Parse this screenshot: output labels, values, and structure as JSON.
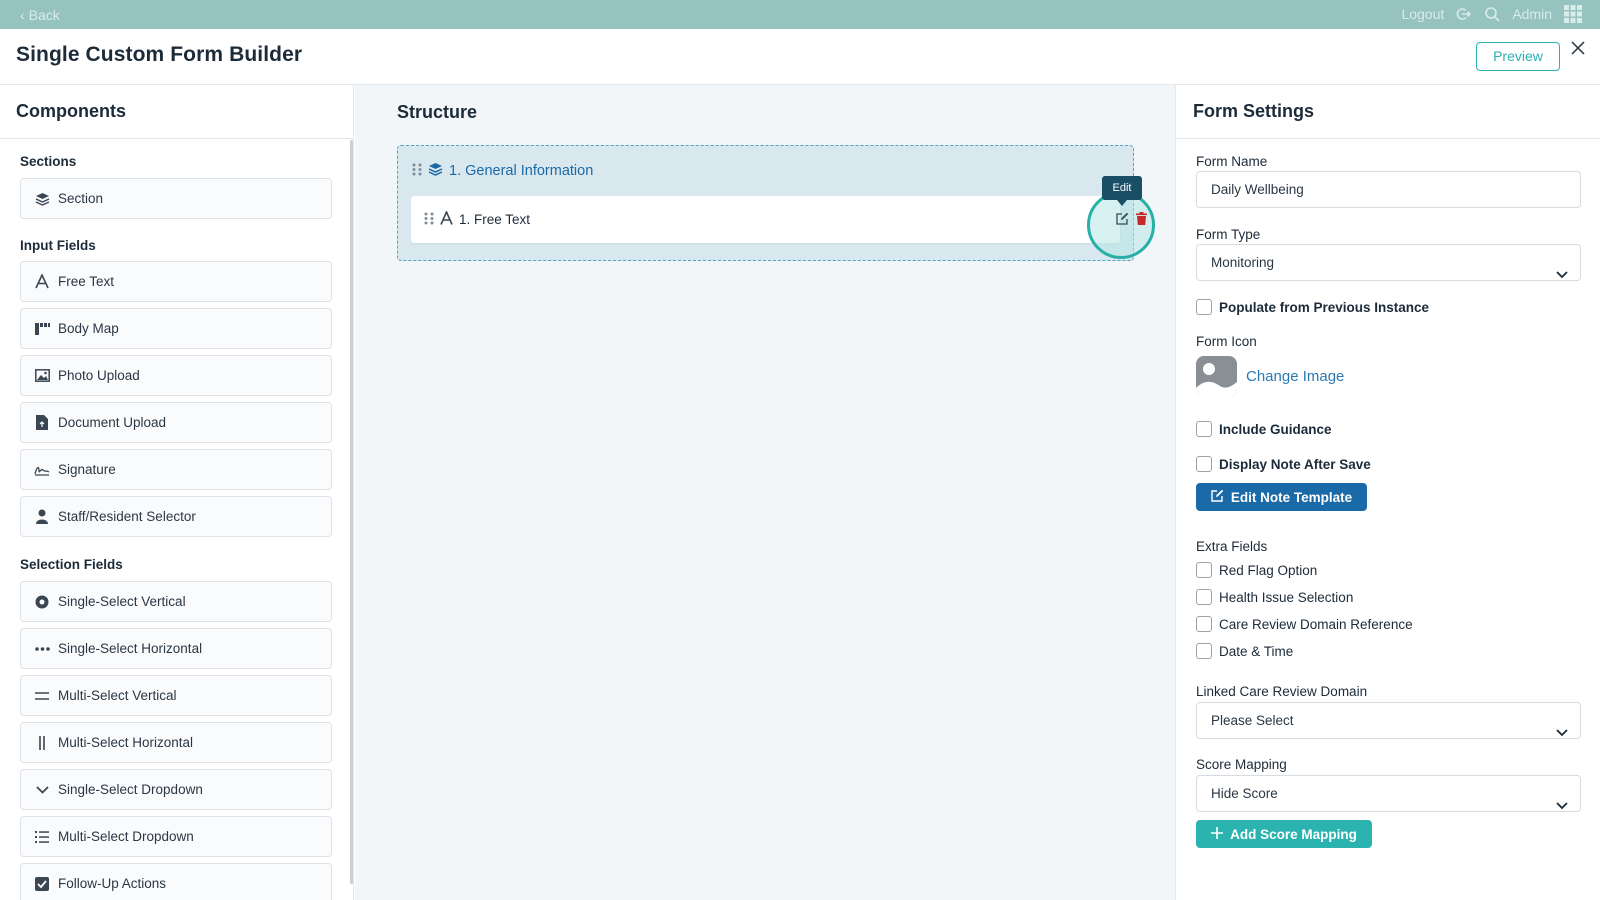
{
  "topbar": {
    "back_label": "Back",
    "logout_label": "Logout",
    "user_label": "Admin"
  },
  "header": {
    "title": "Single Custom Form Builder",
    "preview_label": "Preview"
  },
  "components": {
    "title": "Components",
    "groups": [
      {
        "label": "Sections",
        "items": [
          {
            "label": "Section",
            "icon": "layers-icon"
          }
        ]
      },
      {
        "label": "Input Fields",
        "items": [
          {
            "label": "Free Text",
            "icon": "text-a-icon"
          },
          {
            "label": "Body Map",
            "icon": "body-map-icon"
          },
          {
            "label": "Photo Upload",
            "icon": "image-icon"
          },
          {
            "label": "Document Upload",
            "icon": "file-icon"
          },
          {
            "label": "Signature",
            "icon": "signature-icon"
          },
          {
            "label": "Staff/Resident Selector",
            "icon": "user-icon"
          }
        ]
      },
      {
        "label": "Selection Fields",
        "items": [
          {
            "label": "Single-Select Vertical",
            "icon": "radio-icon"
          },
          {
            "label": "Single-Select Horizontal",
            "icon": "dots-horizontal-icon"
          },
          {
            "label": "Multi-Select Vertical",
            "icon": "equals-icon"
          },
          {
            "label": "Multi-Select Horizontal",
            "icon": "vertical-bars-icon"
          },
          {
            "label": "Single-Select Dropdown",
            "icon": "chevron-down-icon"
          },
          {
            "label": "Multi-Select Dropdown",
            "icon": "list-icon"
          },
          {
            "label": "Follow-Up Actions",
            "icon": "checkbox-checked-icon"
          }
        ]
      }
    ]
  },
  "structure": {
    "title": "Structure",
    "section_label": "1. General Information",
    "field_label": "1. Free Text",
    "tooltip": "Edit"
  },
  "settings": {
    "title": "Form Settings",
    "form_name_label": "Form Name",
    "form_name_value": "Daily Wellbeing",
    "form_type_label": "Form Type",
    "form_type_value": "Monitoring",
    "populate_label": "Populate from Previous Instance",
    "form_icon_label": "Form Icon",
    "change_image_label": "Change Image",
    "include_guidance_label": "Include Guidance",
    "display_note_label": "Display Note After Save",
    "edit_note_label": "Edit Note Template",
    "extra_fields_label": "Extra Fields",
    "extra_fields": [
      {
        "label": "Red Flag Option",
        "checked": false
      },
      {
        "label": "Health Issue Selection",
        "checked": false
      },
      {
        "label": "Care Review Domain Reference",
        "checked": false
      },
      {
        "label": "Date & Time",
        "checked": false
      }
    ],
    "linked_domain_label": "Linked Care Review Domain",
    "linked_domain_value": "Please Select",
    "score_mapping_label": "Score Mapping",
    "score_mapping_value": "Hide Score",
    "add_score_label": "Add Score Mapping"
  },
  "colors": {
    "primary": "#1b6aa8",
    "accent": "#2bb3b0",
    "danger": "#c62828",
    "topbar": "#96c2c0"
  }
}
